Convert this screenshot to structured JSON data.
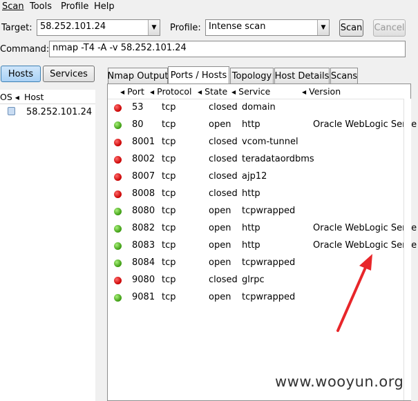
{
  "menu": [
    "Scan",
    "Tools",
    "Profile",
    "Help"
  ],
  "target": {
    "label": "Target:",
    "value": "58.252.101.24"
  },
  "profile": {
    "label": "Profile:",
    "value": "Intense scan"
  },
  "buttons": {
    "scan": "Scan",
    "cancel": "Cancel"
  },
  "command": {
    "label": "Command:",
    "value": "nmap -T4 -A -v 58.252.101.24"
  },
  "sidebar": {
    "hosts_btn": "Hosts",
    "services_btn": "Services",
    "col_os": "OS",
    "col_host": "Host",
    "hosts": [
      {
        "name": "58.252.101.24"
      }
    ]
  },
  "tabs": [
    "Nmap Output",
    "Ports / Hosts",
    "Topology",
    "Host Details",
    "Scans"
  ],
  "columns": {
    "port": "Port",
    "protocol": "Protocol",
    "state": "State",
    "service": "Service",
    "version": "Version"
  },
  "ports": [
    {
      "status": "red",
      "port": "53",
      "protocol": "tcp",
      "state": "closed",
      "service": "domain",
      "version": ""
    },
    {
      "status": "green",
      "port": "80",
      "protocol": "tcp",
      "state": "open",
      "service": "http",
      "version": "Oracle WebLogic Serve"
    },
    {
      "status": "red",
      "port": "8001",
      "protocol": "tcp",
      "state": "closed",
      "service": "vcom-tunnel",
      "version": ""
    },
    {
      "status": "red",
      "port": "8002",
      "protocol": "tcp",
      "state": "closed",
      "service": "teradataordbms",
      "version": ""
    },
    {
      "status": "red",
      "port": "8007",
      "protocol": "tcp",
      "state": "closed",
      "service": "ajp12",
      "version": ""
    },
    {
      "status": "red",
      "port": "8008",
      "protocol": "tcp",
      "state": "closed",
      "service": "http",
      "version": ""
    },
    {
      "status": "green",
      "port": "8080",
      "protocol": "tcp",
      "state": "open",
      "service": "tcpwrapped",
      "version": ""
    },
    {
      "status": "green",
      "port": "8082",
      "protocol": "tcp",
      "state": "open",
      "service": "http",
      "version": "Oracle WebLogic Serve"
    },
    {
      "status": "green",
      "port": "8083",
      "protocol": "tcp",
      "state": "open",
      "service": "http",
      "version": "Oracle WebLogic Serve"
    },
    {
      "status": "green",
      "port": "8084",
      "protocol": "tcp",
      "state": "open",
      "service": "tcpwrapped",
      "version": ""
    },
    {
      "status": "red",
      "port": "9080",
      "protocol": "tcp",
      "state": "closed",
      "service": "glrpc",
      "version": ""
    },
    {
      "status": "green",
      "port": "9081",
      "protocol": "tcp",
      "state": "open",
      "service": "tcpwrapped",
      "version": ""
    }
  ],
  "watermark": "www.wooyun.org",
  "colors": {
    "annotation_arrow": "#e8262a",
    "open": "#3b9a10",
    "closed": "#c80000"
  }
}
